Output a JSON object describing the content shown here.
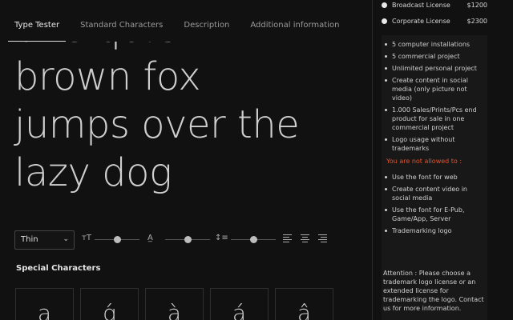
{
  "tabs": [
    "Type Tester",
    "Standard Characters",
    "Description",
    "Additional information"
  ],
  "sample_lines": [
    "The quick",
    "brown fox",
    "jumps over the",
    "lazy dog"
  ],
  "controls": {
    "weight": "Thin",
    "size_icon": "text-size-icon",
    "tracking_icon": "tracking-icon",
    "leading_icon": "line-height-icon",
    "size_level": 0.5,
    "tracking_level": 0.5,
    "leading_level": 0.5
  },
  "special_title": "Special Characters",
  "glyphs": [
    "a",
    "ǵ",
    "à",
    "á",
    "â"
  ],
  "licenses": [
    {
      "name": "Broadcast License",
      "price": "$1200"
    },
    {
      "name": "Corporate License",
      "price": "$2300"
    }
  ],
  "allowed": [
    "5 computer installations",
    "5 commercial project",
    "Unlimited personal project",
    "Create content in social media (only picture not video)",
    "1.000 Sales/Prints/Pcs end product for sale in one commercial project",
    "Logo usage without trademarks"
  ],
  "not_allowed_label": "You are not allowed to :",
  "not_allowed": [
    "Use the font for web",
    "Create content video in social media",
    "Use the font for E-Pub, Game/App, Server",
    "Trademarking logo"
  ],
  "attention": "Attention : Please choose a trademark logo license or an extended license for trademarking the logo. Contact us for more information.",
  "colors": {
    "accent_warning": "#e0532e",
    "background": "#111111"
  }
}
